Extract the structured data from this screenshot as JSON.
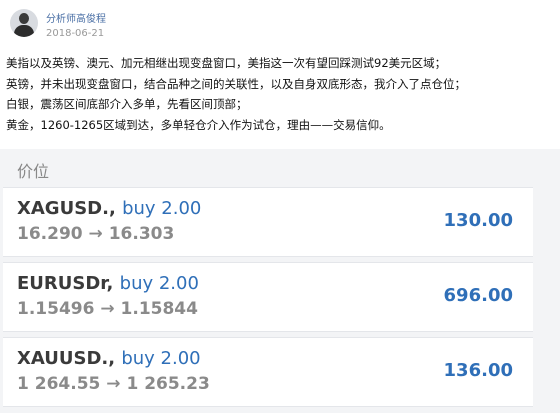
{
  "post": {
    "author": "分析师高俊程",
    "date": "2018-06-21",
    "lines": [
      "美指以及英镑、澳元、加元相继出现变盘窗口，美指这一次有望回踩测试92美元区域；",
      "英镑，并未出现变盘窗口，结合品种之间的关联性，以及自身双底形态，我介入了点仓位；",
      "白银，震荡区间底部介入多单，先看区间顶部；",
      "黄金，1260-1265区域到达，多单轻仓介入作为试仓，理由——交易信仰。"
    ]
  },
  "panel": {
    "title": "价位",
    "trades": [
      {
        "symbol": "XAGUSD.",
        "side": "buy 2.00",
        "open": "16.290",
        "arrow": "→",
        "close": "16.303",
        "profit": "130.00"
      },
      {
        "symbol": "EURUSDr",
        "side": "buy 2.00",
        "open": "1.15496",
        "arrow": "→",
        "close": "1.15844",
        "profit": "696.00"
      },
      {
        "symbol": "XAUUSD.",
        "side": "buy 2.00",
        "open": "1 264.55",
        "arrow": "→",
        "close": "1 265.23",
        "profit": "136.00"
      }
    ]
  }
}
